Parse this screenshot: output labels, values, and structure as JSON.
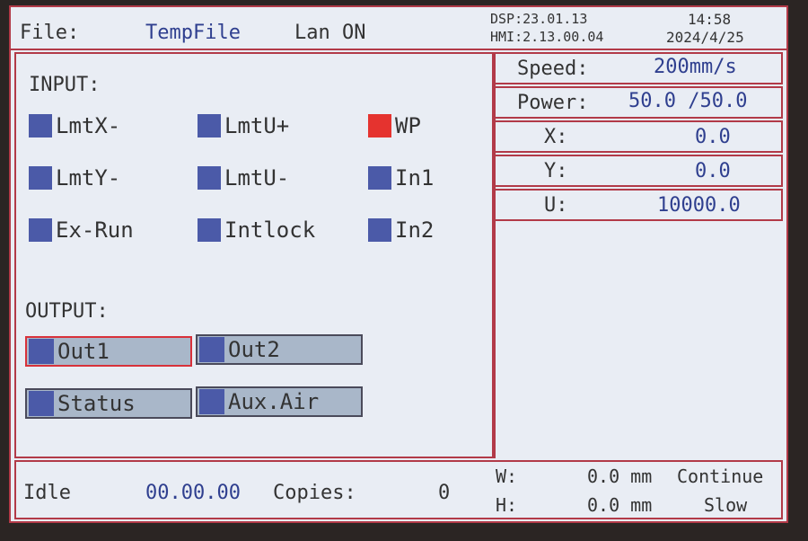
{
  "header": {
    "file_label": "File:",
    "file_name": "TempFile",
    "lan_status": "Lan ON",
    "dsp_version": "DSP:23.01.13",
    "hmi_version": "HMI:2.13.00.04",
    "time": "14:58",
    "date": "2024/4/25"
  },
  "input": {
    "title": "INPUT:",
    "items": [
      {
        "label": "LmtX-",
        "active": false
      },
      {
        "label": "LmtU+",
        "active": false
      },
      {
        "label": "WP",
        "active": true
      },
      {
        "label": "LmtY-",
        "active": false
      },
      {
        "label": "LmtU-",
        "active": false
      },
      {
        "label": "In1",
        "active": false
      },
      {
        "label": "Ex-Run",
        "active": false
      },
      {
        "label": "Intlock",
        "active": false
      },
      {
        "label": "In2",
        "active": false
      }
    ]
  },
  "output": {
    "title": "OUTPUT:",
    "items": [
      {
        "label": "Out1",
        "selected": true
      },
      {
        "label": "Out2",
        "selected": false
      },
      {
        "label": "Status",
        "selected": false
      },
      {
        "label": "Aux.Air",
        "selected": false
      }
    ]
  },
  "params": {
    "speed_label": "Speed:",
    "speed_value": "200mm/s",
    "power_label": "Power:",
    "power_value": "50.0 /50.0",
    "x_label": "X:",
    "x_value": "0.0",
    "y_label": "Y:",
    "y_value": "0.0",
    "u_label": "U:",
    "u_value": "10000.0"
  },
  "footer": {
    "state": "Idle",
    "elapsed": "00.00.00",
    "copies_label": "Copies:",
    "copies_value": "0",
    "w_label": "W:",
    "w_value": "0.0 mm",
    "h_label": "H:",
    "h_value": "0.0 mm",
    "mode1": "Continue",
    "mode2": "Slow"
  },
  "colors": {
    "frame": "#b23a48",
    "screen_bg": "#e9edf4",
    "indicator_off": "#4b5aa8",
    "indicator_on": "#e5332f",
    "value_text": "#2f3f8f"
  }
}
